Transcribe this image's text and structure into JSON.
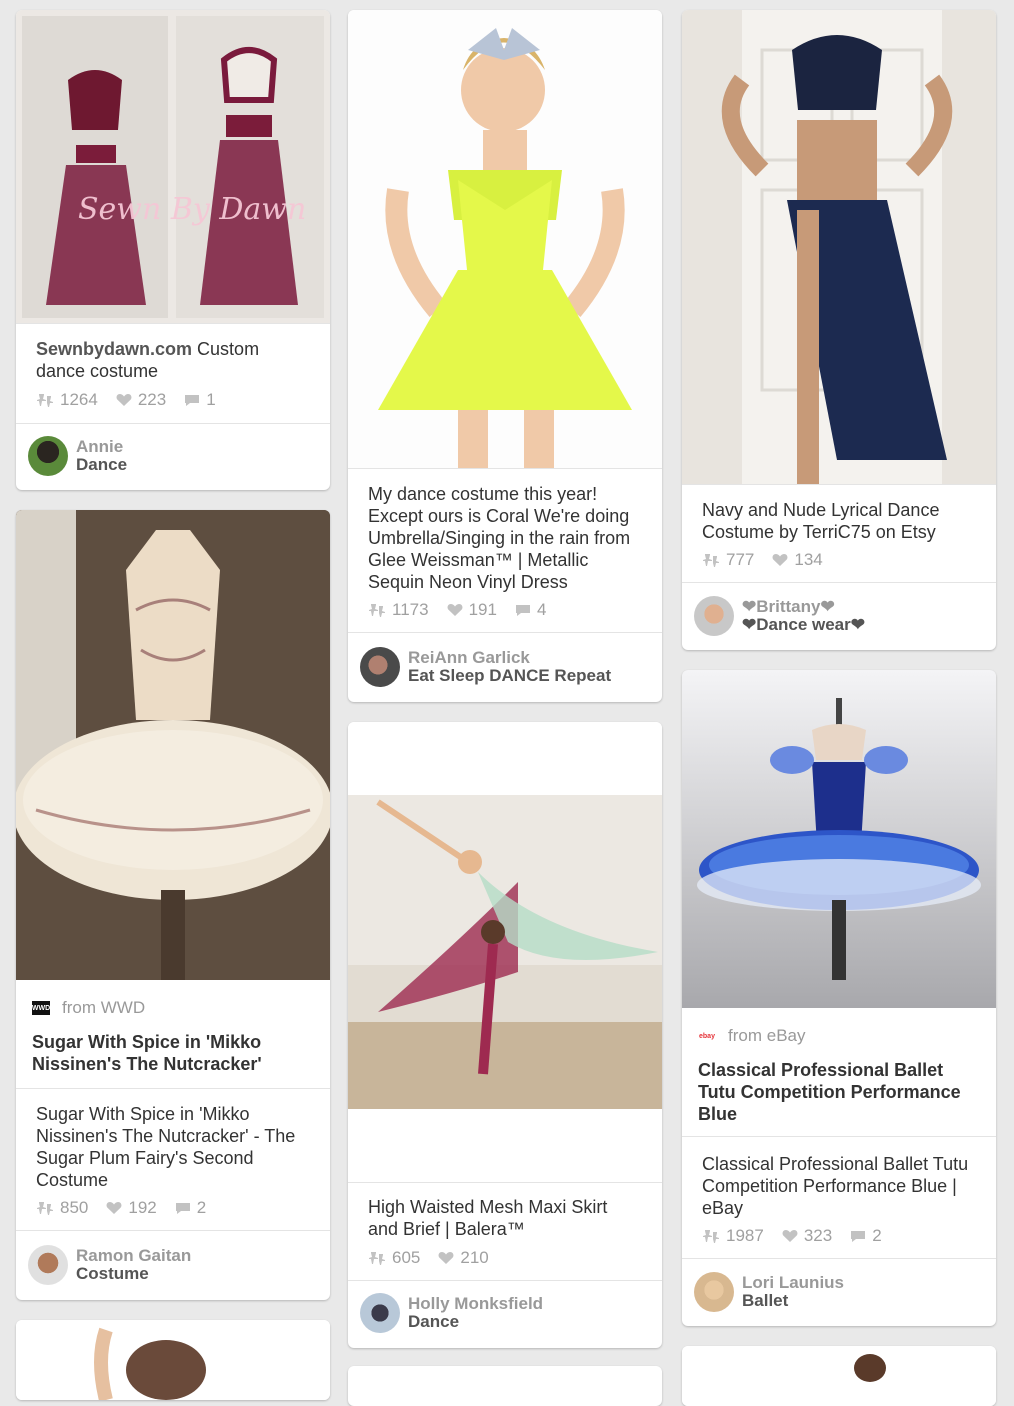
{
  "pins": [
    {
      "id": "pin1",
      "description": {
        "bold": "Sewnbydawn.com",
        "rest": " Custom dance costume"
      },
      "repins": "1264",
      "likes": "223",
      "comments": "1",
      "image_watermark": "Sewn By Dawn",
      "pinner": {
        "name": "Annie",
        "board": "Dance"
      }
    },
    {
      "id": "pin2",
      "description": {
        "bold": "",
        "rest": "My dance costume this year! Except ours is Coral We're doing Umbrella/Singing in the rain from Glee Weissman™ | Metallic Sequin Neon Vinyl Dress"
      },
      "repins": "1173",
      "likes": "191",
      "comments": "4",
      "pinner": {
        "name": "ReiAnn Garlick",
        "board": "Eat Sleep DANCE Repeat"
      }
    },
    {
      "id": "pin3",
      "description": {
        "bold": "",
        "rest": "Navy and Nude Lyrical Dance Costume by TerriC75 on Etsy"
      },
      "repins": "777",
      "likes": "134",
      "pinner": {
        "name": "❤Brittany❤",
        "board": "❤Dance wear❤"
      }
    },
    {
      "id": "pin4",
      "source": {
        "prefix": "from",
        "site": "WWD",
        "logo_text": "WWD"
      },
      "rich_title": "Sugar With Spice in 'Mikko Nissinen's The Nutcracker'",
      "description": {
        "bold": "",
        "rest": "Sugar With Spice in 'Mikko Nissinen's The Nutcracker' - The Sugar Plum Fairy's Second Costume"
      },
      "repins": "850",
      "likes": "192",
      "comments": "2",
      "pinner": {
        "name": "Ramon Gaitan",
        "board": "Costume"
      }
    },
    {
      "id": "pin5",
      "description": {
        "bold": "",
        "rest": "High Waisted Mesh Maxi Skirt and Brief | Balera™"
      },
      "repins": "605",
      "likes": "210",
      "pinner": {
        "name": "Holly Monksfield",
        "board": "Dance"
      }
    },
    {
      "id": "pin6",
      "source": {
        "prefix": "from",
        "site": "eBay",
        "logo_text": "ebay"
      },
      "rich_title": "Classical Professional Ballet Tutu Competition Performance Blue",
      "description": {
        "bold": "",
        "rest": "Classical Professional Ballet Tutu Competition Performance Blue | eBay"
      },
      "repins": "1987",
      "likes": "323",
      "comments": "2",
      "pinner": {
        "name": "Lori Launius",
        "board": "Ballet"
      }
    }
  ],
  "icons": {
    "repin": "pushpin-icon",
    "like": "heart-icon",
    "comment": "comment-icon"
  },
  "colors": {
    "background": "#e9e9e9",
    "card": "#ffffff",
    "meta_text": "#a0a0a0"
  }
}
